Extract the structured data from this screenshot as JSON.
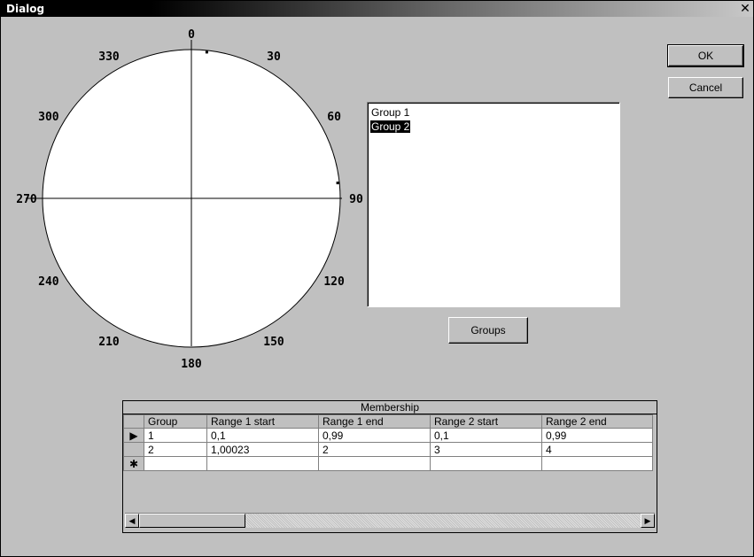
{
  "window": {
    "title": "Dialog",
    "close_glyph": "✕"
  },
  "buttons": {
    "ok": "OK",
    "cancel": "Cancel",
    "groups": "Groups"
  },
  "polar_plot": {
    "angle_labels": [
      "0",
      "30",
      "60",
      "90",
      "120",
      "150",
      "180",
      "210",
      "240",
      "270",
      "300",
      "330"
    ],
    "points": [
      {
        "angle_deg": 6
      },
      {
        "angle_deg": 84
      }
    ]
  },
  "group_list": {
    "items": [
      {
        "label": "Group 1",
        "selected": false
      },
      {
        "label": "Group 2",
        "selected": true
      }
    ]
  },
  "membership_table": {
    "caption": "Membership",
    "columns": [
      "Group",
      "Range 1 start",
      "Range 1 end",
      "Range 2 start",
      "Range 2 end"
    ],
    "rows": [
      {
        "marker": "current-row-arrow-icon",
        "cells": [
          "1",
          "0,1",
          "0,99",
          "0,1",
          "0,99"
        ]
      },
      {
        "marker": "",
        "cells": [
          "2",
          "1,00023",
          "2",
          "3",
          "4"
        ]
      },
      {
        "marker": "new-row-star-icon",
        "cells": [
          "",
          "",
          "",
          "",
          ""
        ]
      }
    ]
  },
  "icons": {
    "current_row": "▶",
    "new_row": "✱",
    "scroll_left": "◀",
    "scroll_right": "▶"
  }
}
